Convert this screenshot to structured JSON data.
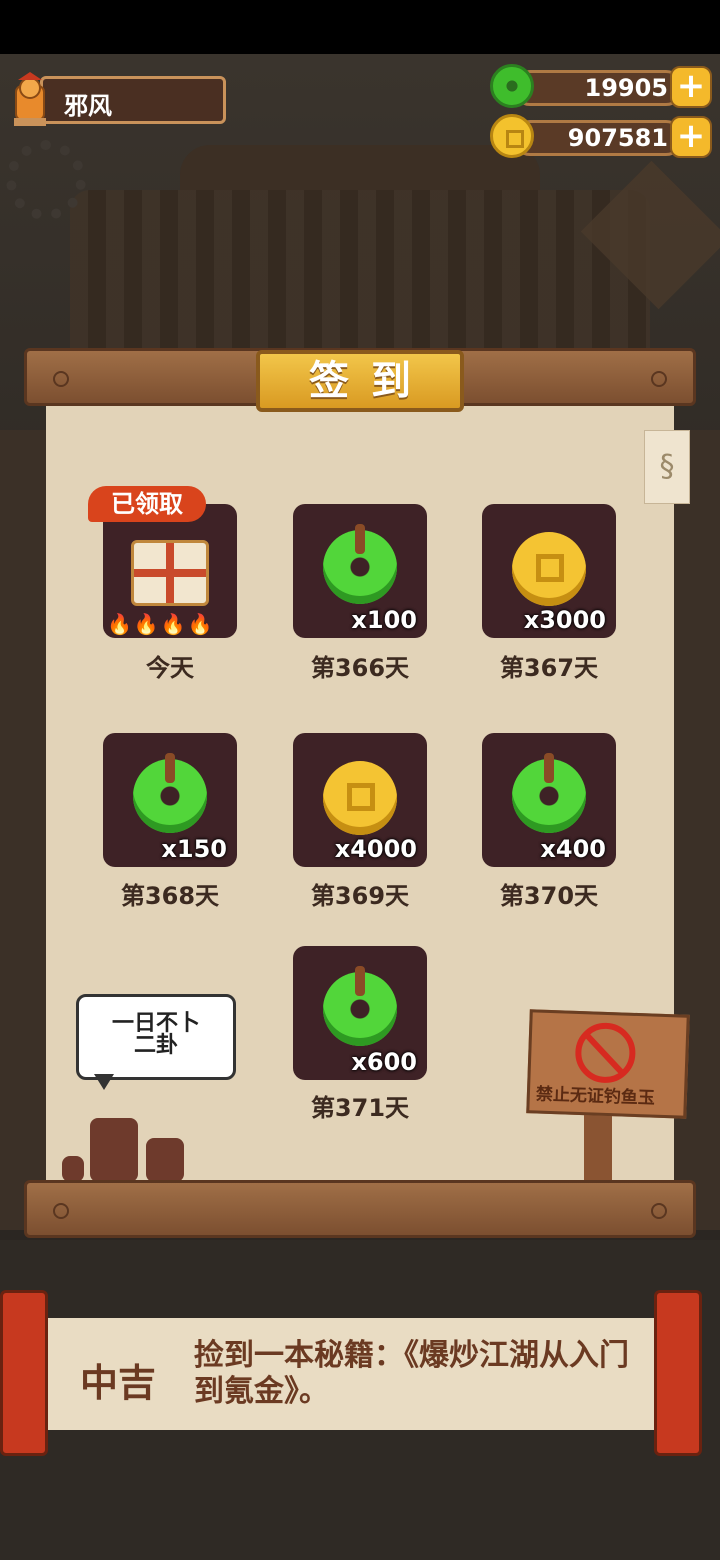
{
  "player": {
    "name": "邪风"
  },
  "currency": [
    {
      "type": "jade",
      "value": "19905",
      "icon": "jade-coin-icon"
    },
    {
      "type": "gold",
      "value": "907581",
      "icon": "gold-coin-icon"
    }
  ],
  "signin": {
    "title": "签到",
    "claimed_badge": "已领取",
    "days": [
      {
        "label": "今天",
        "reward": "gift",
        "amount": "",
        "claimed": true
      },
      {
        "label": "第366天",
        "reward": "jade",
        "amount": "x100"
      },
      {
        "label": "第367天",
        "reward": "gold",
        "amount": "x3000"
      },
      {
        "label": "第368天",
        "reward": "jade",
        "amount": "x150"
      },
      {
        "label": "第369天",
        "reward": "gold",
        "amount": "x4000"
      },
      {
        "label": "第370天",
        "reward": "jade",
        "amount": "x400"
      },
      {
        "label": "第371天",
        "reward": "jade",
        "amount": "x600"
      }
    ]
  },
  "decor": {
    "bubble_line1": "一日不卜",
    "bubble_line2": "二卦",
    "sign_text": "禁止无证钓鱼玉"
  },
  "fortune": {
    "level": "中吉",
    "text": "捡到一本秘籍：《爆炒江湖从入门到氪金》。"
  }
}
